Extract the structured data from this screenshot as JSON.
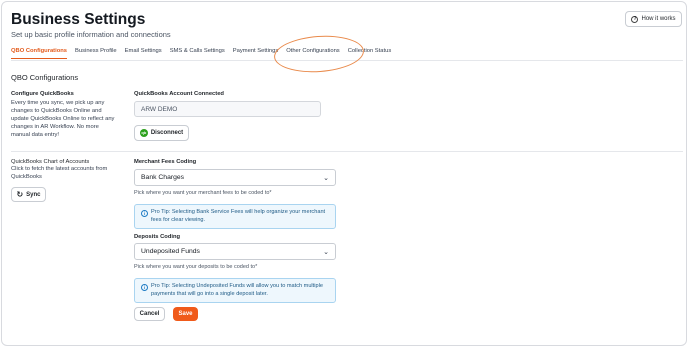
{
  "header": {
    "title": "Business Settings",
    "subtitle": "Set up basic profile information and connections",
    "how_it_works_label": "How it works",
    "how_it_works_icon": "question-circle-icon"
  },
  "tabs": [
    {
      "label": "QBO Configurations",
      "active": true
    },
    {
      "label": "Business Profile",
      "active": false
    },
    {
      "label": "Email Settings",
      "active": false
    },
    {
      "label": "SMS & Calls Settings",
      "active": false
    },
    {
      "label": "Payment Settings",
      "active": false
    },
    {
      "label": "Other Configurations",
      "active": false
    },
    {
      "label": "Collection Status",
      "active": false
    }
  ],
  "accent_color": "#e35a1b",
  "section_title": "QBO Configurations",
  "configure": {
    "title": "Configure QuickBooks",
    "description": "Every time you sync, we pick up any changes to QuickBooks Online and update QuickBooks Online to reflect any changes in AR Workflow. No more manual data entry!",
    "account_label": "QuickBooks Account Connected",
    "account_value": "ARW DEMO",
    "disconnect_label": "Disconnect",
    "qb_icon_text": "qb"
  },
  "chart_of_accounts": {
    "title": "QuickBooks Chart of Accounts",
    "description": "Click to fetch the latest accounts from QuickBooks",
    "sync_label": "Sync"
  },
  "merchant_fees": {
    "label": "Merchant Fees Coding",
    "selected": "Bank Charges",
    "hint": "Pick where you want your merchant fees to be coded to*",
    "tip": "Pro Tip: Selecting Bank Service Fees will help organize your merchant fees for clear viewing."
  },
  "deposits": {
    "label": "Deposits Coding",
    "selected": "Undeposited Funds",
    "hint": "Pick where you want your deposits to be coded to*",
    "tip": "Pro Tip: Selecting Undeposited Funds will allow you to match multiple payments that will go into a single deposit later."
  },
  "actions": {
    "cancel_label": "Cancel",
    "save_label": "Save"
  }
}
